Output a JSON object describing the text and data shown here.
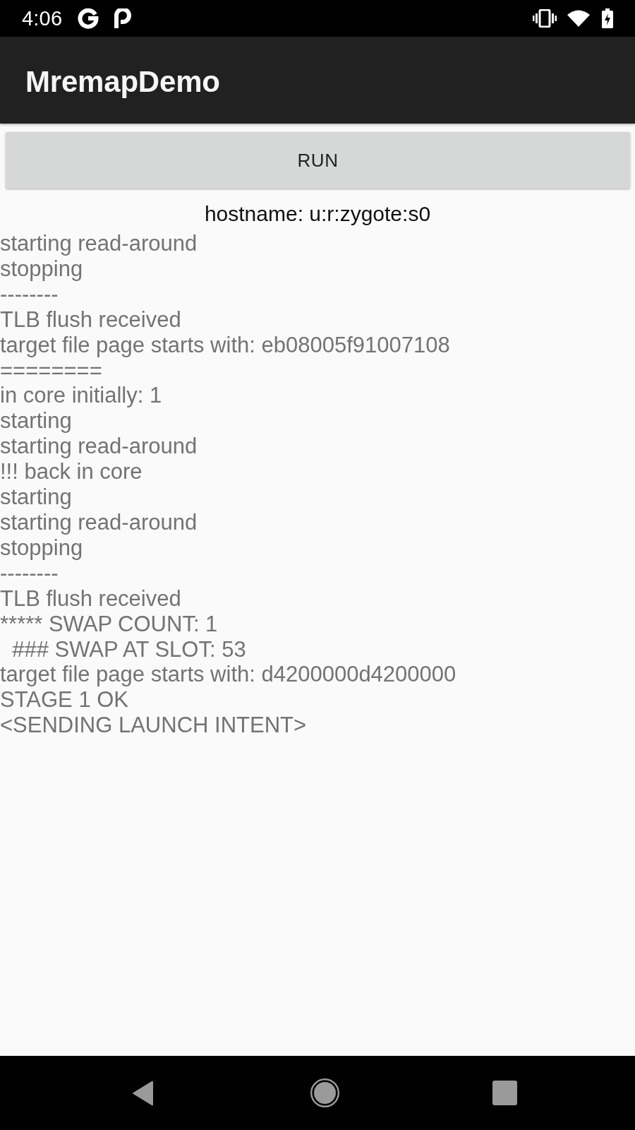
{
  "status_bar": {
    "time": "4:06"
  },
  "app_bar": {
    "title": "MremapDemo"
  },
  "run_button": {
    "label": "RUN"
  },
  "hostname": "hostname: u:r:zygote:s0",
  "log_lines": [
    "starting read-around",
    "stopping",
    "--------",
    "TLB flush received",
    "target file page starts with: eb08005f91007108",
    "========",
    "in core initially: 1",
    "starting",
    "starting read-around",
    "!!! back in core",
    "starting",
    "starting read-around",
    "stopping",
    "--------",
    "TLB flush received",
    "***** SWAP COUNT: 1",
    "  ### SWAP AT SLOT: 53",
    "target file page starts with: d4200000d4200000",
    "STAGE 1 OK",
    "<SENDING LAUNCH INTENT>"
  ]
}
